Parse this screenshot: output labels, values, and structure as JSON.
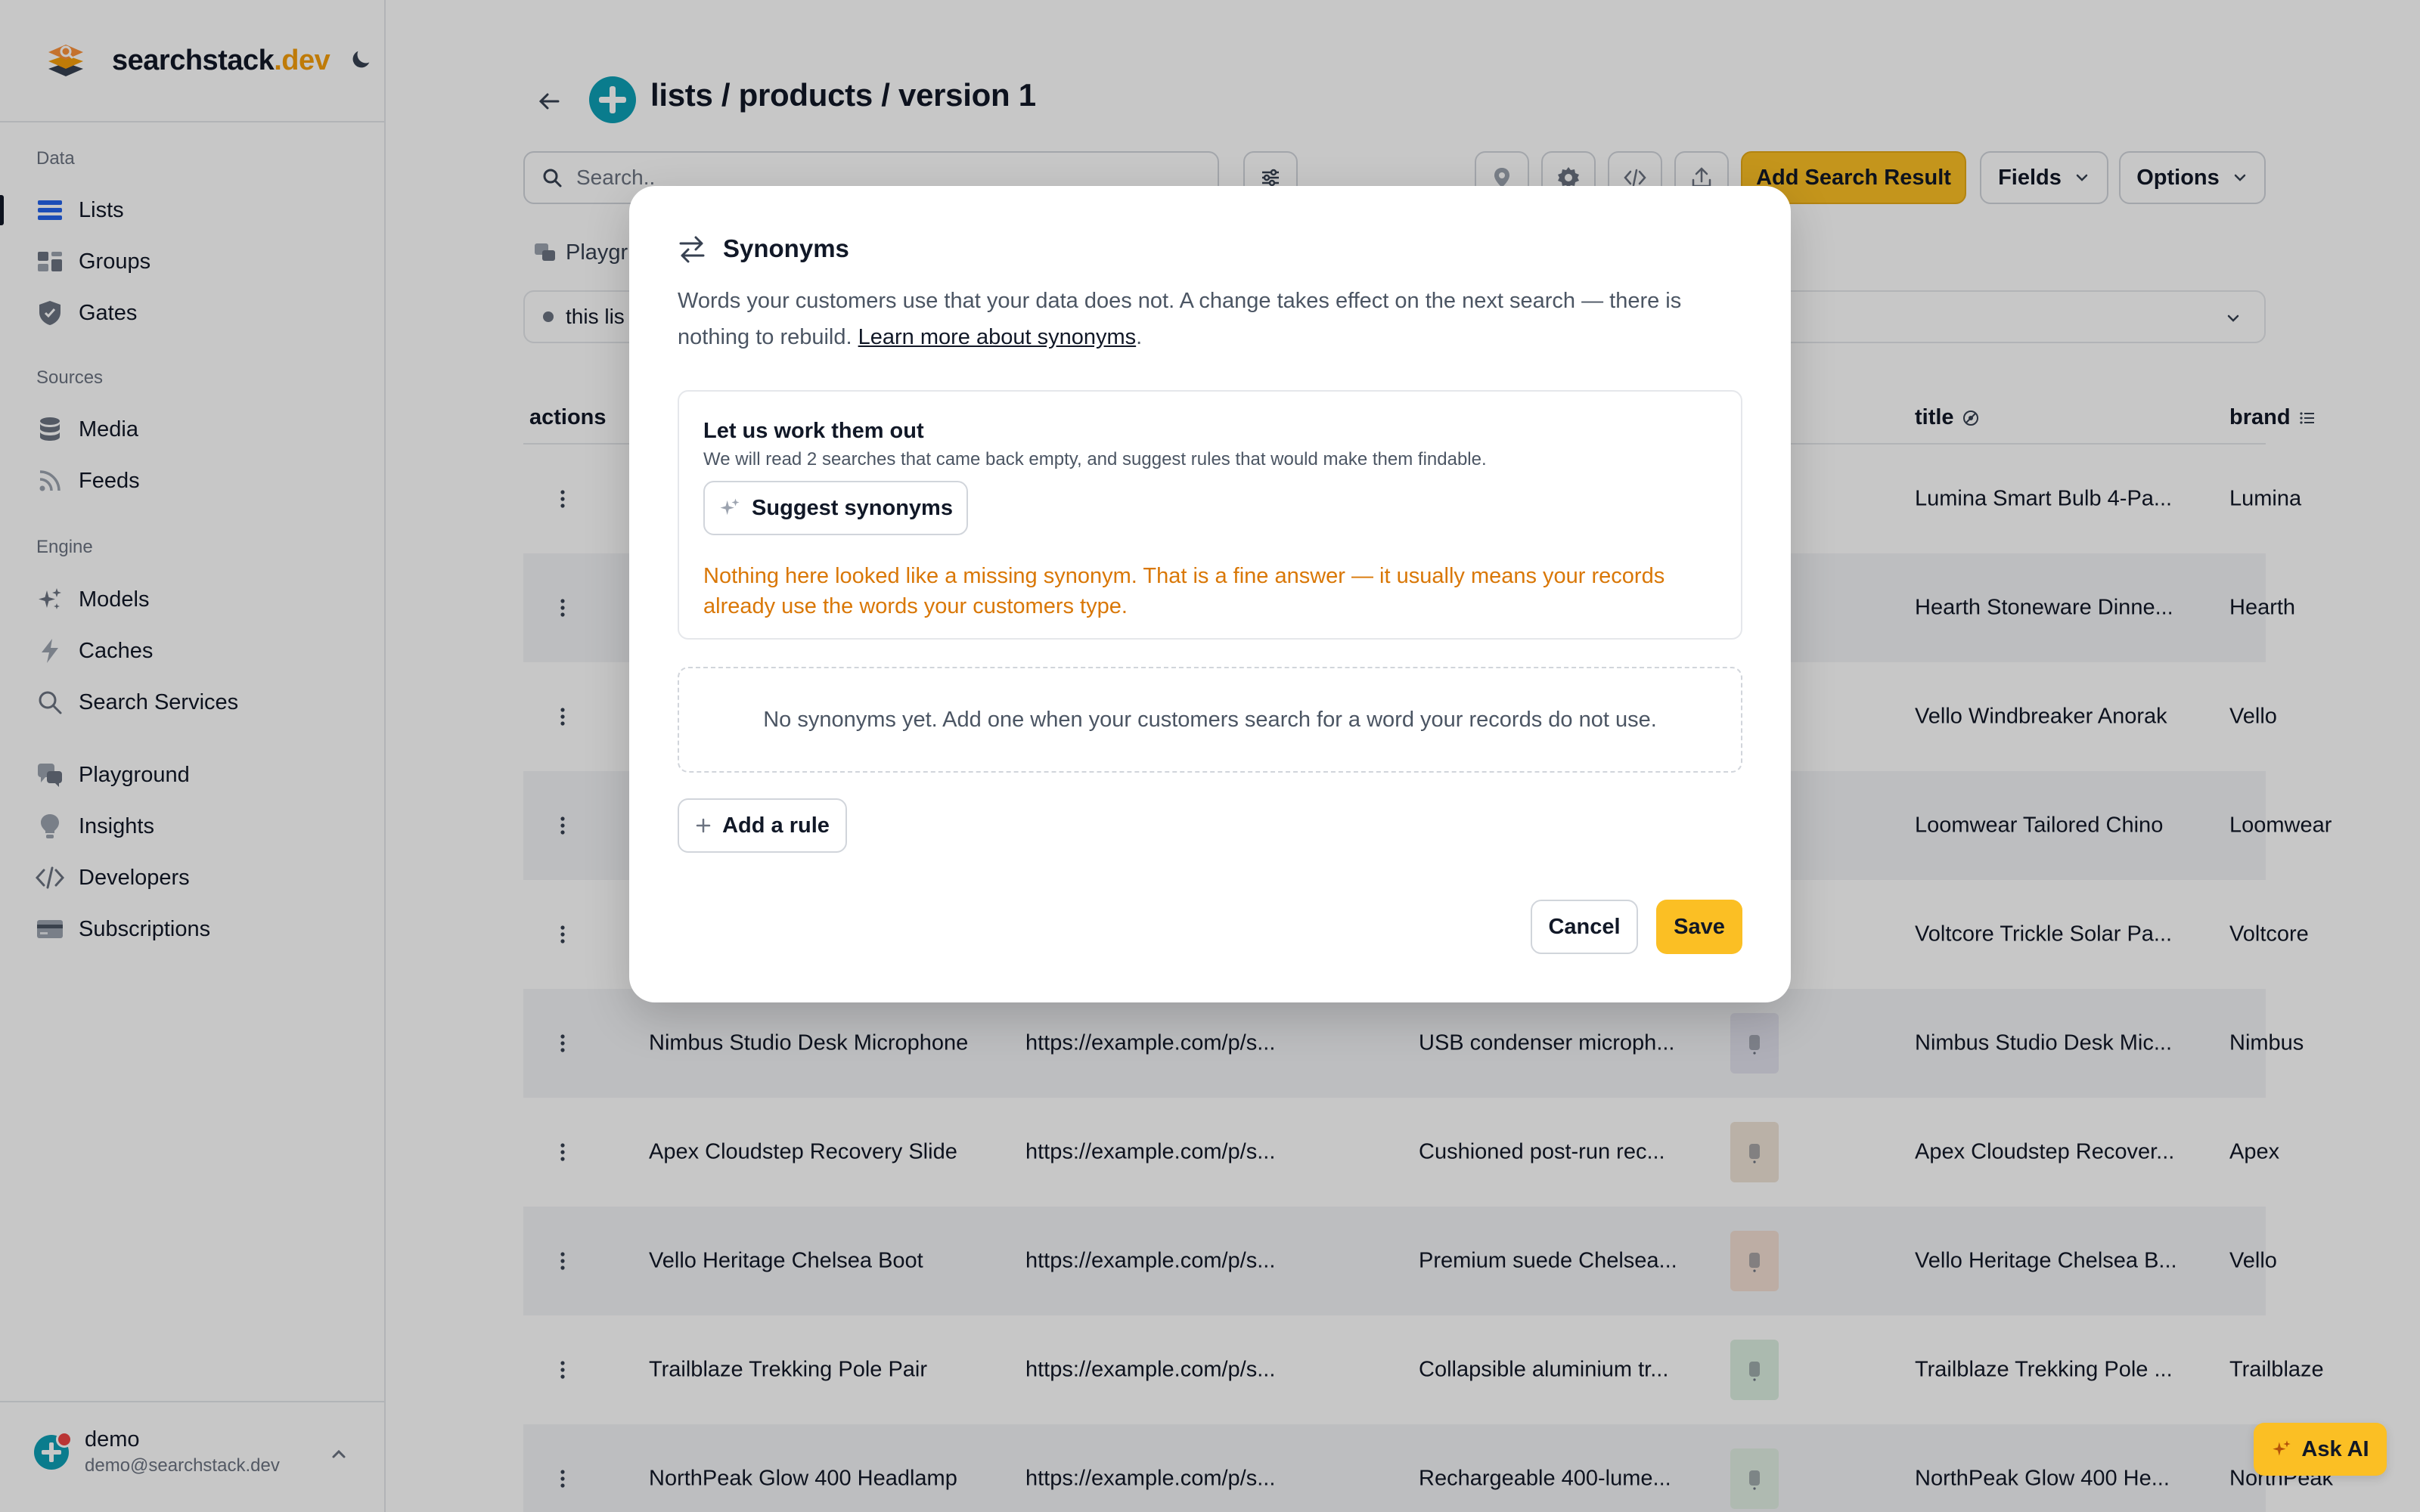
{
  "brand": {
    "name": "searchstack",
    "tld": ".dev"
  },
  "sidebar": {
    "sections": [
      {
        "label": "Data"
      },
      {
        "label": "Sources"
      },
      {
        "label": "Engine"
      }
    ],
    "items": [
      {
        "label": "Lists",
        "icon": "list-icon",
        "active": true
      },
      {
        "label": "Groups",
        "icon": "groups-icon"
      },
      {
        "label": "Gates",
        "icon": "shield-icon"
      },
      {
        "label": "Media",
        "icon": "database-icon"
      },
      {
        "label": "Feeds",
        "icon": "rss-icon"
      },
      {
        "label": "Models",
        "icon": "sparkles-icon"
      },
      {
        "label": "Caches",
        "icon": "bolt-icon"
      },
      {
        "label": "Search Services",
        "icon": "search-icon"
      },
      {
        "label": "Playground",
        "icon": "chat-icon"
      },
      {
        "label": "Insights",
        "icon": "lightbulb-icon"
      },
      {
        "label": "Developers",
        "icon": "code-icon"
      },
      {
        "label": "Subscriptions",
        "icon": "credit-card-icon"
      }
    ],
    "user": {
      "name": "demo",
      "email": "demo@searchstack.dev"
    }
  },
  "header": {
    "title": "lists / products / version 1"
  },
  "toolbar": {
    "search_placeholder": "Search..",
    "add_search_result": "Add Search Result",
    "fields": "Fields",
    "options": "Options"
  },
  "tabs": {
    "playground": "Playgr"
  },
  "filter": {
    "text": "this lis"
  },
  "table": {
    "columns": {
      "actions": "actions",
      "title": "title",
      "brand": "brand"
    },
    "rows": [
      {
        "name": "",
        "url": "",
        "description": "",
        "title": "Lumina Smart Bulb 4-Pa...",
        "brand": "Lumina"
      },
      {
        "name": "",
        "url": "",
        "description": "",
        "title": "Hearth Stoneware Dinne...",
        "brand": "Hearth"
      },
      {
        "name": "",
        "url": "",
        "description": "",
        "title": "Vello Windbreaker Anorak",
        "brand": "Vello"
      },
      {
        "name": "",
        "url": "",
        "description": "",
        "title": "Loomwear Tailored Chino",
        "brand": "Loomwear"
      },
      {
        "name": "",
        "url": "",
        "description": "",
        "title": "Voltcore Trickle Solar Pa...",
        "brand": "Voltcore"
      },
      {
        "name": "Nimbus Studio Desk Microphone",
        "url": "https://example.com/p/s...",
        "description": "USB condenser microph...",
        "title": "Nimbus Studio Desk Mic...",
        "brand": "Nimbus",
        "thumb_color": "#e0e0ec"
      },
      {
        "name": "Apex Cloudstep Recovery Slide",
        "url": "https://example.com/p/s...",
        "description": "Cushioned post-run rec...",
        "title": "Apex Cloudstep Recover...",
        "brand": "Apex",
        "thumb_color": "#efe3d6"
      },
      {
        "name": "Vello Heritage Chelsea Boot",
        "url": "https://example.com/p/s...",
        "description": "Premium suede Chelsea...",
        "title": "Vello Heritage Chelsea B...",
        "brand": "Vello",
        "thumb_color": "#f2ded2"
      },
      {
        "name": "Trailblaze Trekking Pole Pair",
        "url": "https://example.com/p/s...",
        "description": "Collapsible aluminium tr...",
        "title": "Trailblaze Trekking Pole ...",
        "brand": "Trailblaze",
        "thumb_color": "#dcefe1"
      },
      {
        "name": "NorthPeak Glow 400 Headlamp",
        "url": "https://example.com/p/s...",
        "description": "Rechargeable 400-lume...",
        "title": "NorthPeak Glow 400 He...",
        "brand": "NorthPeak",
        "thumb_color": "#e1efe3"
      }
    ]
  },
  "modal": {
    "title": "Synonyms",
    "description": "Words your customers use that your data does not. A change takes effect on the next search — there is nothing to rebuild.",
    "learn_more": "Learn more about synonyms",
    "suggest": {
      "title": "Let us work them out",
      "subtitle": "We will read 2 searches that came back empty, and suggest rules that would make them findable.",
      "button": "Suggest synonyms",
      "note": "Nothing here looked like a missing synonym. That is a fine answer — it usually means your records already use the words your customers type."
    },
    "empty": "No synonyms yet. Add one when your customers search for a word your records do not use.",
    "add_rule": "Add a rule",
    "cancel": "Cancel",
    "save": "Save"
  },
  "ask_ai": "Ask AI",
  "colors": {
    "accent": "#fbbf24",
    "brand_orange": "#f59e0b",
    "note_orange": "#d97706",
    "teal": "#0e9fb5"
  }
}
